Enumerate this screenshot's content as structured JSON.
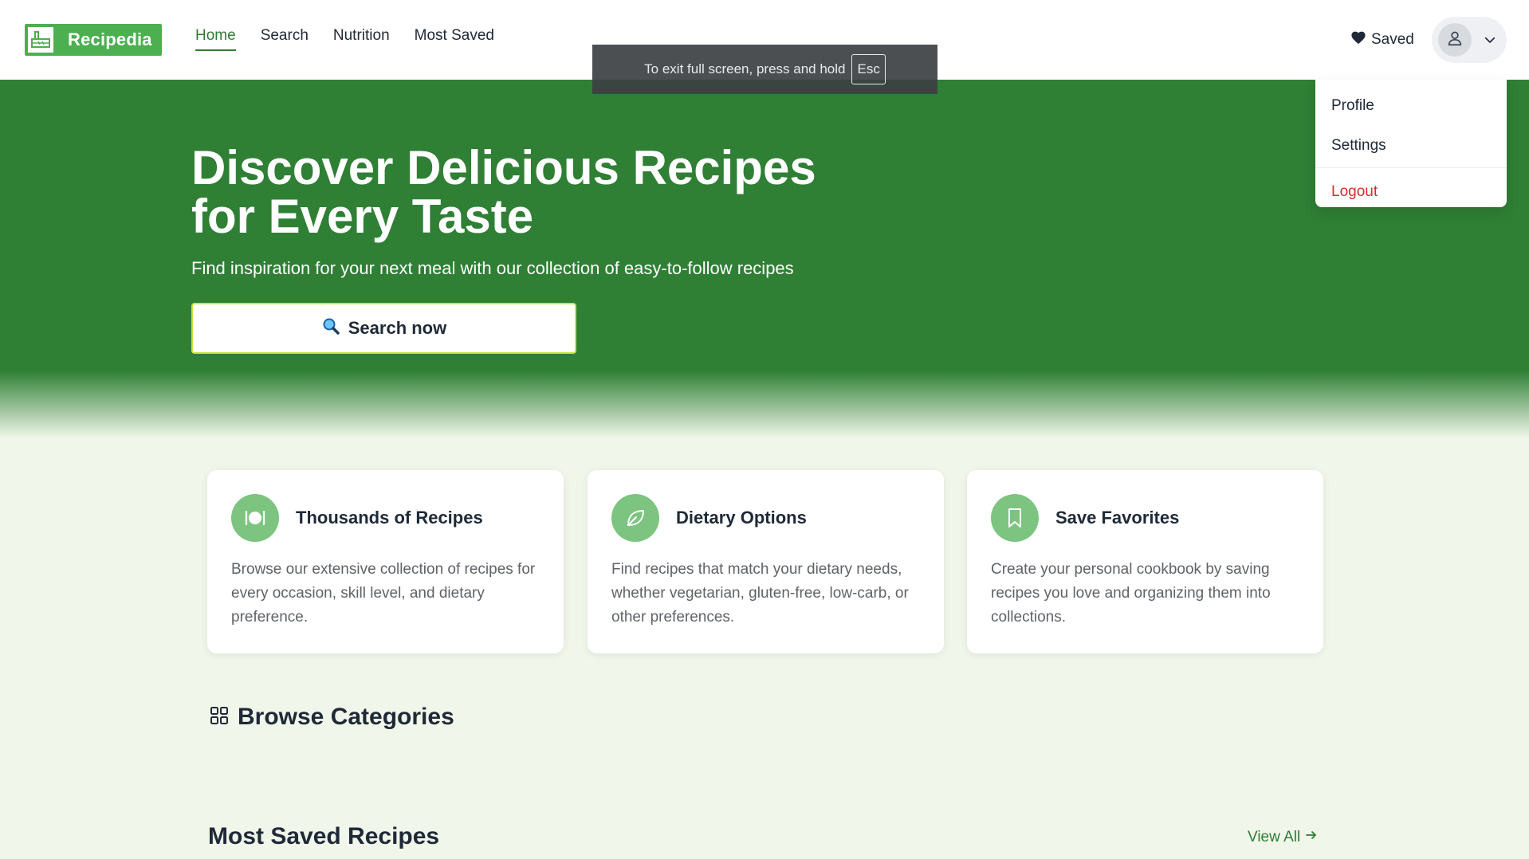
{
  "brand": {
    "name": "Recipedia"
  },
  "nav": {
    "items": [
      {
        "label": "Home",
        "active": true
      },
      {
        "label": "Search",
        "active": false
      },
      {
        "label": "Nutrition",
        "active": false
      },
      {
        "label": "Most Saved",
        "active": false
      }
    ]
  },
  "header": {
    "saved_label": "Saved"
  },
  "toast": {
    "message": "To exit full screen, press and hold",
    "key": "Esc"
  },
  "user_menu": {
    "items": [
      {
        "label": "Profile"
      },
      {
        "label": "Settings"
      },
      {
        "label": "Logout"
      }
    ]
  },
  "hero": {
    "title": "Discover Delicious Recipes\nfor Every Taste",
    "subtitle": "Find inspiration for your next meal with our collection of easy-to-follow recipes",
    "button_label": "Search now",
    "button_icon": "magnifying-glass-emoji"
  },
  "features": [
    {
      "icon": "plate-utensils-icon",
      "title": "Thousands of Recipes",
      "text": "Browse our extensive collection of recipes for every occasion, skill level, and dietary preference."
    },
    {
      "icon": "leaf-icon",
      "title": "Dietary Options",
      "text": "Find recipes that match your dietary needs, whether vegetarian, gluten-free, low-carb, or other preferences."
    },
    {
      "icon": "bookmark-icon",
      "title": "Save Favorites",
      "text": "Create your personal cookbook by saving recipes you love and organizing them into collections."
    }
  ],
  "sections": {
    "categories_title": "Browse Categories",
    "most_saved_title": "Most Saved Recipes",
    "view_all_label": "View All"
  },
  "colors": {
    "brand_green": "#4caf50",
    "hero_green": "#2f7f35",
    "accent_icon_green": "#7cc47f",
    "logout_red": "#d32f2f",
    "page_bg": "#f1f6ea"
  }
}
